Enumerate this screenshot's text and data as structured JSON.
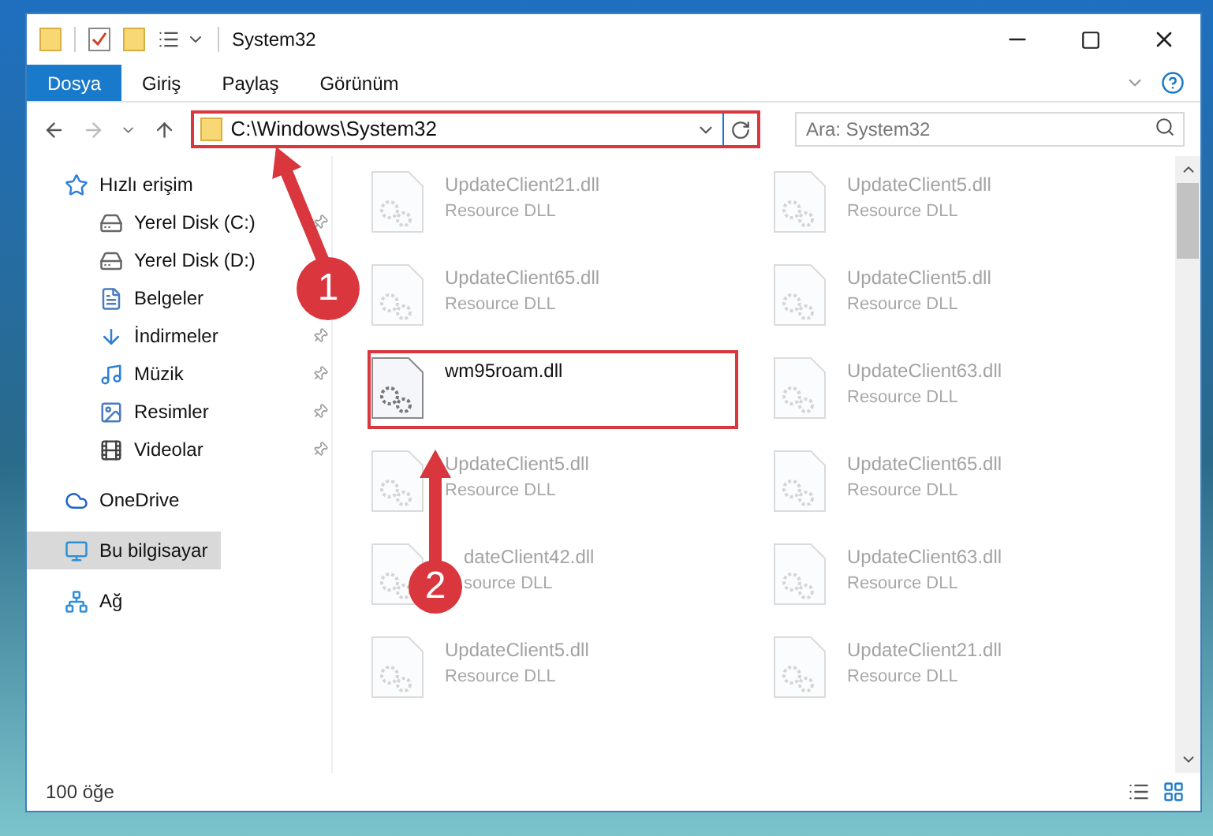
{
  "window": {
    "title": "System32"
  },
  "ribbon_tabs": [
    {
      "label": "Dosya",
      "selected": true
    },
    {
      "label": "Giriş",
      "selected": false
    },
    {
      "label": "Paylaş",
      "selected": false
    },
    {
      "label": "Görünüm",
      "selected": false
    }
  ],
  "address_bar": {
    "path": "C:\\Windows\\System32",
    "highlighted": true
  },
  "search": {
    "placeholder": "Ara: System32"
  },
  "sidebar": {
    "items": [
      {
        "label": "Hızlı erişim",
        "selected": false,
        "children": [
          {
            "label": "Yerel Disk (C:)",
            "pinned": true,
            "selected": false
          },
          {
            "label": "Yerel Disk (D:)",
            "selected": false
          },
          {
            "label": "Belgeler",
            "selected": false
          },
          {
            "label": "İndirmeler",
            "pinned": true,
            "selected": false
          },
          {
            "label": "Müzik",
            "pinned": true,
            "selected": false
          },
          {
            "label": "Resimler",
            "pinned": true,
            "selected": false
          },
          {
            "label": "Videolar",
            "pinned": true,
            "selected": false
          }
        ]
      },
      {
        "label": "OneDrive",
        "selected": false
      },
      {
        "label": "Bu bilgisayar",
        "selected": true
      },
      {
        "label": "Ağ",
        "selected": false
      }
    ]
  },
  "files": [
    {
      "name": "UpdateClient21.dll",
      "type": "Resource DLL",
      "kind": "faded"
    },
    {
      "name": "UpdateClient5.dll",
      "type": "Resource DLL",
      "kind": "faded"
    },
    {
      "name": "UpdateClient65.dll",
      "type": "Resource DLL",
      "kind": "faded"
    },
    {
      "name": "UpdateClient5.dll",
      "type": "Resource DLL",
      "kind": "faded"
    },
    {
      "name": "wm95roam.dll",
      "kind": "highlighted"
    },
    {
      "name": "UpdateClient63.dll",
      "type": "Resource DLL",
      "kind": "faded"
    },
    {
      "name": "UpdateClient5.dll",
      "type": "Resource DLL",
      "kind": "faded"
    },
    {
      "name": "UpdateClient65.dll",
      "type": "Resource DLL",
      "kind": "faded"
    },
    {
      "name": "dateClient42.dll",
      "type": "source DLL",
      "kind": "covered"
    },
    {
      "name": "UpdateClient63.dll",
      "type": "Resource DLL",
      "kind": "faded"
    },
    {
      "name": "UpdateClient5.dll",
      "type": "Resource DLL",
      "kind": "faded"
    },
    {
      "name": "UpdateClient21.dll",
      "type": "Resource DLL",
      "kind": "faded"
    }
  ],
  "callouts": [
    {
      "number": "1"
    },
    {
      "number": "2"
    }
  ],
  "status_bar": {
    "item_count": "100 öğe"
  }
}
